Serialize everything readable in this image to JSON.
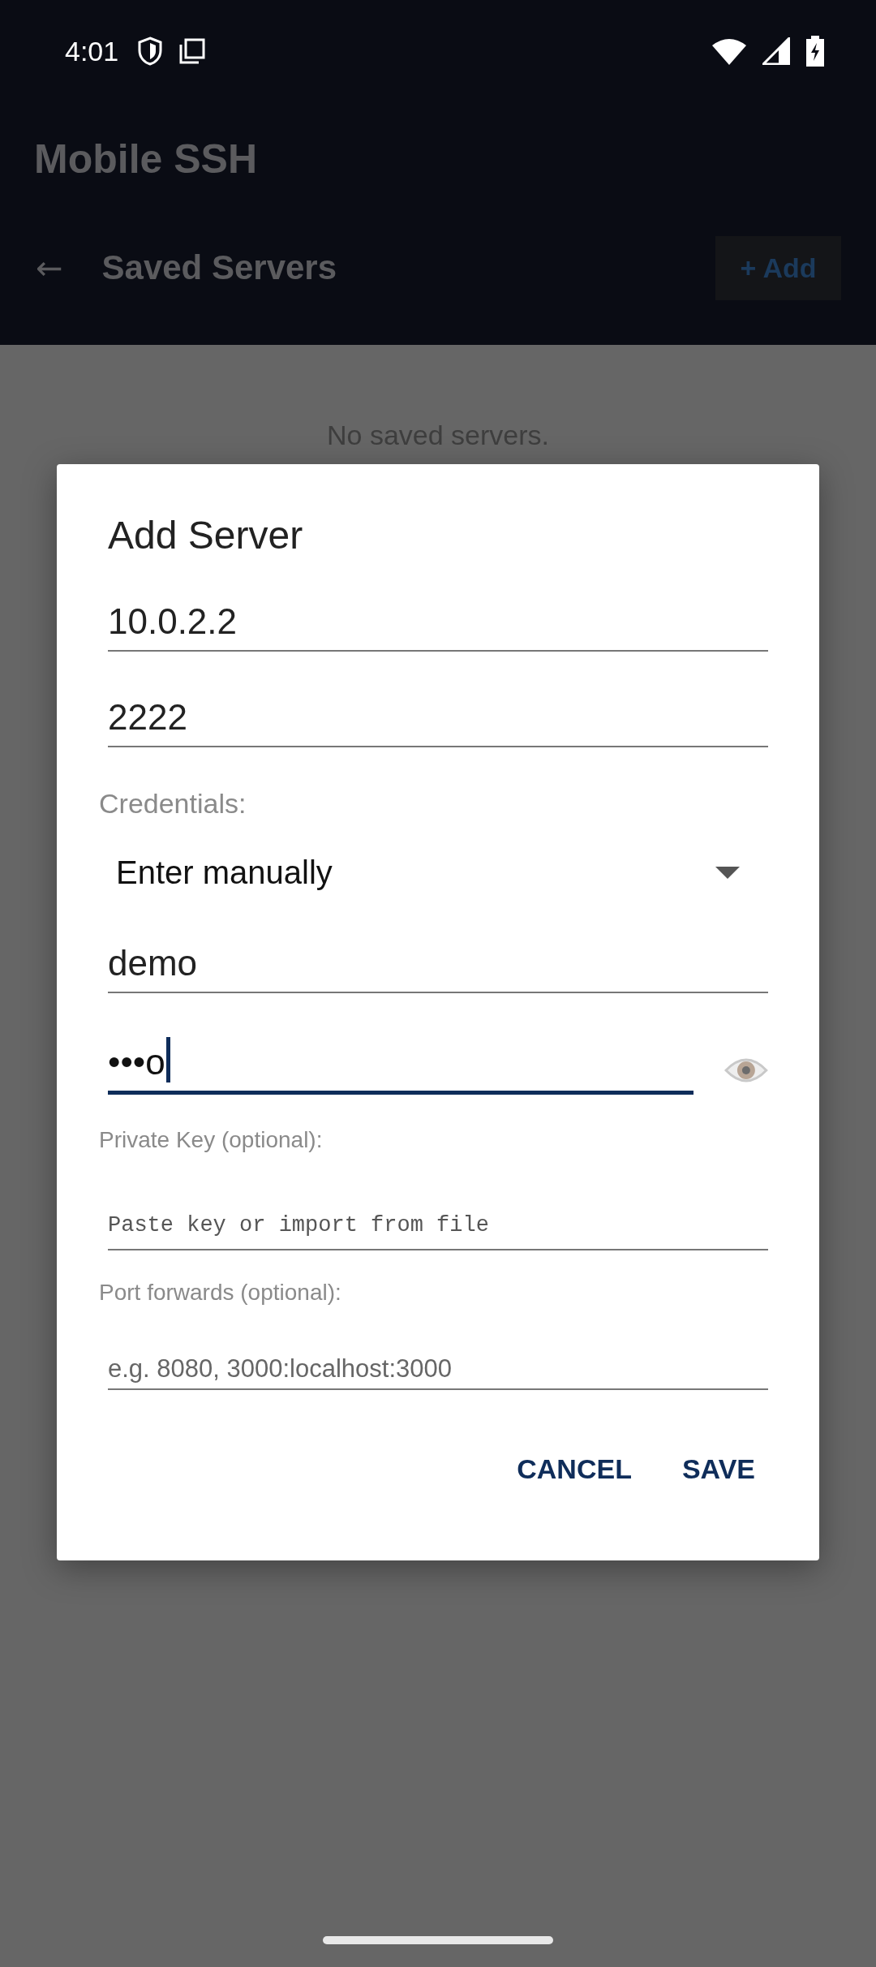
{
  "status_bar": {
    "time": "4:01"
  },
  "app_bar": {
    "title": "Mobile SSH"
  },
  "toolbar": {
    "back": "←",
    "title": "Saved Servers",
    "add_button": "+ Add"
  },
  "empty_message": "No saved servers.",
  "dialog": {
    "title": "Add Server",
    "fields": [
      {
        "kind": "text",
        "value": "10.0.2.2",
        "focused": false
      },
      {
        "kind": "text",
        "value": "2222",
        "focused": false
      },
      {
        "kind": "label",
        "text": "Credentials:"
      },
      {
        "kind": "select",
        "value": "Enter manually"
      },
      {
        "kind": "text",
        "value": "demo",
        "focused": false
      },
      {
        "kind": "password",
        "value": "•••o",
        "focused": true
      },
      {
        "kind": "small-label",
        "text": "Private Key (optional):"
      },
      {
        "kind": "mono",
        "placeholder": "Paste key or import from file",
        "focused": false
      },
      {
        "kind": "small-label",
        "text": "Port forwards (optional):"
      },
      {
        "kind": "small",
        "placeholder": "e.g. 8080, 3000:localhost:3000",
        "focused": false
      }
    ],
    "buttons": [
      "CANCEL",
      "SAVE"
    ]
  }
}
